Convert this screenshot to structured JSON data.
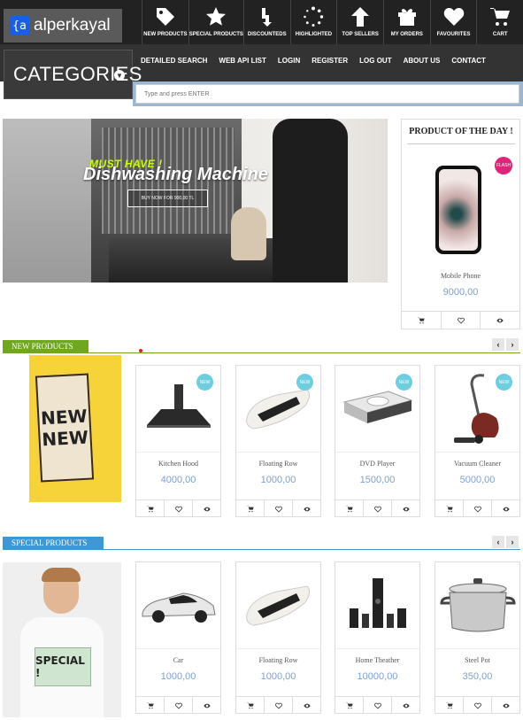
{
  "brand": {
    "mark": "{a",
    "name": "alperkayal"
  },
  "nav_icons": [
    {
      "label": "NEW PRODUCTS",
      "icon": "tag-icon"
    },
    {
      "label": "SPECIAL PRODUCTS",
      "icon": "star-icon"
    },
    {
      "label": "DISCOUNTEDS",
      "icon": "down-arrow-icon"
    },
    {
      "label": "HIGHLIGHTED",
      "icon": "spinner-icon"
    },
    {
      "label": "TOP SELLERS",
      "icon": "up-arrow-icon"
    },
    {
      "label": "MY ORDERS",
      "icon": "gift-icon"
    },
    {
      "label": "FAVOURITES",
      "icon": "heart-icon"
    },
    {
      "label": "CART",
      "icon": "cart-icon"
    }
  ],
  "categories_label": "CATEGORIES",
  "links": [
    "DETAILED SEARCH",
    "WEB API LIST",
    "LOGIN",
    "REGISTER",
    "LOG OUT",
    "ABOUT US",
    "CONTACT"
  ],
  "search": {
    "placeholder": "Type and press ENTER"
  },
  "hero": {
    "kicker": "MUST HAVE !",
    "title": "Dishwashing Machine",
    "button": "BUY NOW FOR 900,00 TL"
  },
  "product_of_day": {
    "heading": "PRODUCT OF THE DAY !",
    "badge": "FLASH",
    "name": "Mobile Phone",
    "price": "9000,00"
  },
  "new_products": {
    "heading": "NEW PRODUCTS",
    "color": "#6fa81f",
    "banner_text": [
      "NEW",
      "NEW"
    ],
    "items": [
      {
        "name": "Kitchen Hood",
        "price": "4000,00",
        "badge": "NEW"
      },
      {
        "name": "Floating Row",
        "price": "1000,00",
        "badge": "NEW"
      },
      {
        "name": "DVD Player",
        "price": "1500,00",
        "badge": "NEW"
      },
      {
        "name": "Vacuum Cleaner",
        "price": "5000,00",
        "badge": "NEW"
      }
    ]
  },
  "special_products": {
    "heading": "SPECIAL PRODUCTS",
    "color": "#3e98d6",
    "banner_text": "SPECIAL !",
    "items": [
      {
        "name": "Car",
        "price": "1000,00"
      },
      {
        "name": "Floating Row",
        "price": "1000,00"
      },
      {
        "name": "Home Theather",
        "price": "10000,00"
      },
      {
        "name": "Steel Pot",
        "price": "350,00"
      }
    ]
  },
  "arrows": {
    "prev": "‹",
    "next": "›"
  }
}
